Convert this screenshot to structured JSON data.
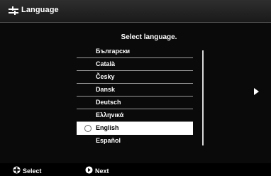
{
  "header": {
    "title": "Language",
    "icon": "tools-icon"
  },
  "dialog": {
    "heading": "Select language.",
    "languages": [
      {
        "label": "Български",
        "selected": false
      },
      {
        "label": "Català",
        "selected": false
      },
      {
        "label": "Česky",
        "selected": false
      },
      {
        "label": "Dansk",
        "selected": false
      },
      {
        "label": "Deutsch",
        "selected": false
      },
      {
        "label": "Ελληνικά",
        "selected": false
      },
      {
        "label": "English",
        "selected": true
      },
      {
        "label": "Español",
        "selected": false
      }
    ],
    "next_page_icon": "arrow-right-icon"
  },
  "footer": {
    "select_label": "Select",
    "select_icon": "dpad-icon",
    "next_label": "Next",
    "next_icon": "next-button-icon"
  },
  "colors": {
    "background": "#000000",
    "highlight": "#ffffff",
    "divider": "#9a9a9a"
  }
}
